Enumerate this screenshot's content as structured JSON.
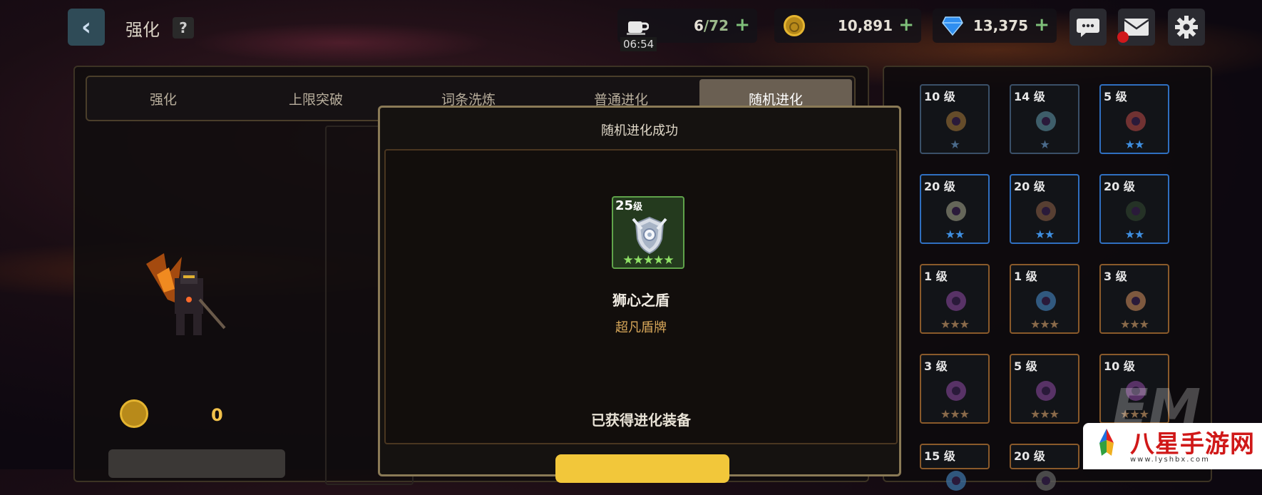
{
  "header": {
    "back_icon": "chevron-left-icon",
    "title": "强化",
    "help_label": "?",
    "stamina": {
      "current": "6",
      "max": "/72",
      "plus": "+",
      "timer": "06:54",
      "icon": "coffee-cup-icon"
    },
    "gold": {
      "value": "10,891",
      "plus": "+",
      "icon": "gold-coin-icon"
    },
    "gems": {
      "value": "13,375",
      "plus": "+",
      "icon": "diamond-icon"
    },
    "icons": [
      "chat-bubble-icon",
      "mail-icon",
      "gear-icon"
    ]
  },
  "tabs": [
    {
      "label": "强化",
      "active": false
    },
    {
      "label": "上限突破",
      "active": false
    },
    {
      "label": "词条洗炼",
      "active": false
    },
    {
      "label": "普通进化",
      "active": false
    },
    {
      "label": "随机进化",
      "active": true
    }
  ],
  "left_panel": {
    "cost_value": "0"
  },
  "modal": {
    "title": "随机进化成功",
    "item_level": "25",
    "level_suffix": "级",
    "item_stars": "★★★★★",
    "item_name": "狮心之盾",
    "item_type": "超凡盾牌",
    "obtained_text": "已获得进化装备"
  },
  "inventory": [
    {
      "level": "10",
      "suffix": "级",
      "stars": "★",
      "star_color": "#4a6a8a",
      "border": "grey"
    },
    {
      "level": "14",
      "suffix": "级",
      "stars": "★",
      "star_color": "#4a6a8a",
      "border": "grey"
    },
    {
      "level": "5",
      "suffix": "级",
      "stars": "★★",
      "star_color": "#3f8fe0",
      "border": "blue"
    },
    {
      "level": "20",
      "suffix": "级",
      "stars": "★★",
      "star_color": "#3f8fe0",
      "border": "blue"
    },
    {
      "level": "20",
      "suffix": "级",
      "stars": "★★",
      "star_color": "#3f8fe0",
      "border": "blue"
    },
    {
      "level": "20",
      "suffix": "级",
      "stars": "★★",
      "star_color": "#3f8fe0",
      "border": "blue"
    },
    {
      "level": "1",
      "suffix": "级",
      "stars": "★★★",
      "star_color": "#8a6a4a",
      "border": "orange"
    },
    {
      "level": "1",
      "suffix": "级",
      "stars": "★★★",
      "star_color": "#8a6a4a",
      "border": "orange"
    },
    {
      "level": "3",
      "suffix": "级",
      "stars": "★★★",
      "star_color": "#8a6a4a",
      "border": "orange"
    },
    {
      "level": "3",
      "suffix": "级",
      "stars": "★★★",
      "star_color": "#8a6a4a",
      "border": "orange"
    },
    {
      "level": "5",
      "suffix": "级",
      "stars": "★★★",
      "star_color": "#8a6a4a",
      "border": "orange"
    },
    {
      "level": "10",
      "suffix": "级",
      "stars": "★★★",
      "star_color": "#8a6a4a",
      "border": "orange"
    },
    {
      "level": "15",
      "suffix": "级",
      "stars": "",
      "star_color": "#8a6a4a",
      "border": "orange"
    },
    {
      "level": "20",
      "suffix": "级",
      "stars": "",
      "star_color": "#8a6a4a",
      "border": "orange"
    }
  ],
  "watermark": {
    "brand": "八星手游网",
    "url": "www.lyshbx.com",
    "overlay": "EM"
  }
}
